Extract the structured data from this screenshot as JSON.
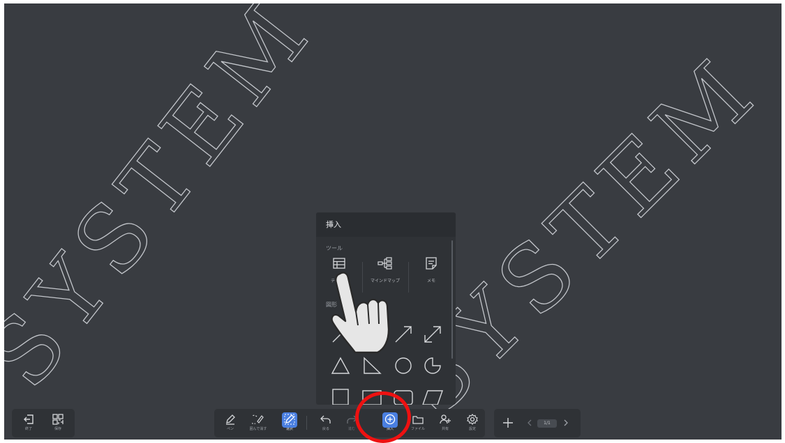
{
  "watermark": {
    "text_left": "SYSTEM",
    "text_right": "SYSTEM"
  },
  "insert_panel": {
    "title": "挿入",
    "tools_section": "ツール",
    "tools": [
      {
        "label": "テーブル",
        "icon": "table-icon"
      },
      {
        "label": "マインドマップ",
        "icon": "mind-map-icon"
      },
      {
        "label": "メモ",
        "icon": "memo-icon"
      }
    ],
    "shapes_section": "図形",
    "shapes": [
      "line",
      "arrow",
      "double-arrow",
      "triangle",
      "right-triangle",
      "circle",
      "pie",
      "square",
      "rectangle",
      "rounded-rectangle",
      "parallelogram"
    ]
  },
  "left_toolbar": {
    "exit_label": "終了",
    "save_label": "保存"
  },
  "main_toolbar": {
    "pen_label": "ペン",
    "lasso_label": "囲んで消す",
    "select_label": "選択",
    "undo_label": "戻る",
    "redo_label": "進む",
    "insert_label": "挿入",
    "file_label": "ファイル",
    "share_label": "共有",
    "settings_label": "設定"
  },
  "page_toolbar": {
    "page_indicator": "1/1"
  },
  "colors": {
    "background": "#393c41",
    "panel": "#2f3236",
    "accent": "#4a7fe0",
    "highlight": "#ee1111"
  }
}
